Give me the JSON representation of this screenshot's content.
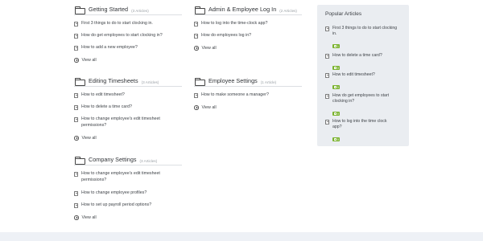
{
  "categories": {
    "getting_started": {
      "title": "Getting Started",
      "count": "(3 Articles)",
      "articles": [
        "First 3 things to do to start clocking in.",
        "How do get employees to start clocking in?",
        "How to add a new employee?"
      ],
      "view_all": "View all"
    },
    "admin_login": {
      "title": "Admin & Employee Log In",
      "count": "(2 Articles)",
      "articles": [
        "How to log into the time-clock app?",
        "How do employees log in?"
      ],
      "view_all": "View all"
    },
    "editing_timesheets": {
      "title": "Editing Timesheets",
      "count": "(3 Articles)",
      "articles": [
        "How to edit timesheet?",
        "How to delete a time card?",
        "How to change employee's edit timesheet permissions?"
      ],
      "view_all": "View all"
    },
    "employee_settings": {
      "title": "Employee Settings",
      "count": "(1 Article)",
      "articles": [
        "How to make someone a manager?"
      ],
      "view_all": "View all"
    },
    "company_settings": {
      "title": "Company Settings",
      "count": "(3 Articles)",
      "articles": [
        "How to change employee's edit timesheet permissions?",
        "How to change employee profiles?",
        "How to set up payroll period options?"
      ],
      "view_all": "View all"
    }
  },
  "popular": {
    "title": "Popular Articles",
    "items": [
      {
        "text": "First 3 things to do to start clocking in.",
        "votes": "1"
      },
      {
        "text": "How to delete a time card?",
        "votes": "0"
      },
      {
        "text": "How to edit timesheet?",
        "votes": "0"
      },
      {
        "text": "How do get employees to start clocking in?",
        "votes": "0"
      },
      {
        "text": "How to log into the time clock app?",
        "votes": "0"
      }
    ]
  },
  "colors": {
    "accent_badge": "#79b22c",
    "sidebar_bg": "#eaedf1",
    "footer_bg": "#eef1f6"
  },
  "icons": {
    "category": "folder-icon",
    "article": "document-icon",
    "view_all": "arrow-circle-icon",
    "vote": "thumbs-up-icon"
  }
}
